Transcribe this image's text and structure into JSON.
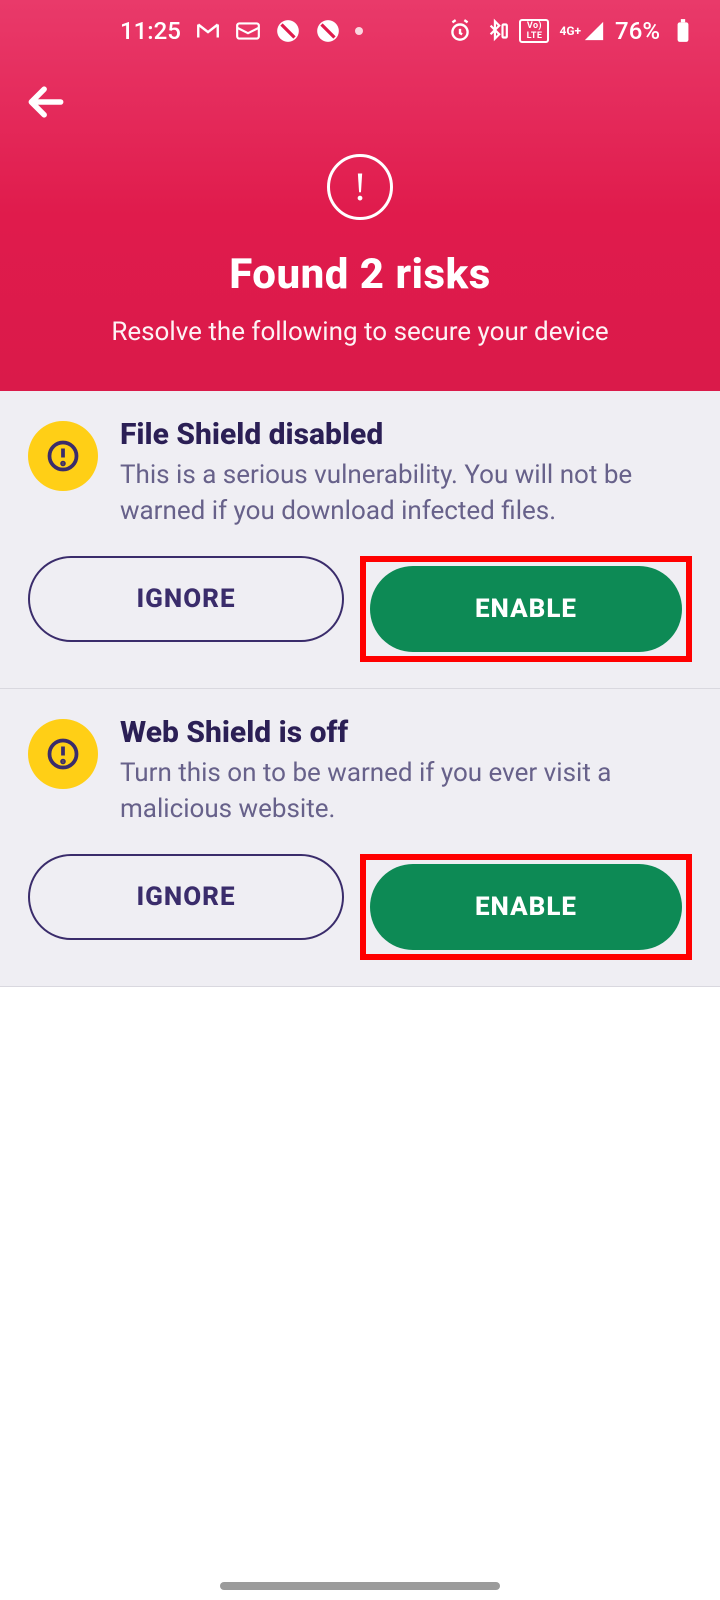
{
  "status": {
    "time": "11:25",
    "lte_top": "Vo)",
    "lte_bot": "LTE",
    "net": "4G+",
    "battery_pct": "76%"
  },
  "header": {
    "title": "Found 2 risks",
    "subtitle": "Resolve the following to secure your device"
  },
  "risks": [
    {
      "title": "File Shield disabled",
      "desc": "This is a serious vulnerability. You will not be warned if you download infected files.",
      "ignore": "IGNORE",
      "enable": "ENABLE"
    },
    {
      "title": "Web Shield is off",
      "desc": "Turn this on to be warned if you ever visit a malicious website.",
      "ignore": "IGNORE",
      "enable": "ENABLE"
    }
  ],
  "colors": {
    "header_grad_top": "#e93a6a",
    "header_grad_bot": "#da1a4a",
    "accent_green": "#0d8a55",
    "accent_yellow": "#ffcf16",
    "highlight": "#ff0000",
    "text_dark": "#2b1f55",
    "text_muted": "#67618a"
  }
}
